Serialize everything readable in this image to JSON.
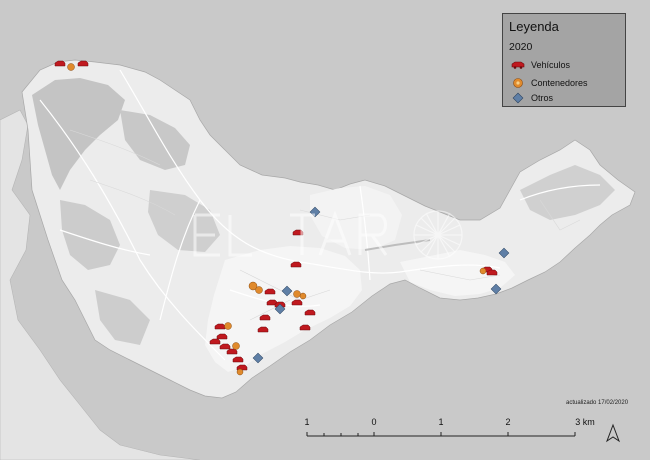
{
  "legend": {
    "title": "Leyenda",
    "year": "2020",
    "items": [
      {
        "label": "Vehículos",
        "symbol": "car-icon",
        "color": "#c0191f"
      },
      {
        "label": "Contenedores",
        "symbol": "container-icon",
        "color": "#e08a2c"
      },
      {
        "label": "Otros",
        "symbol": "diamond-icon",
        "color": "#5f7fa6"
      }
    ]
  },
  "updated_text": "actualizado 17/02/2020",
  "scalebar": {
    "labels": [
      {
        "text": "1",
        "value": -1
      },
      {
        "text": "0",
        "value": 0
      },
      {
        "text": "1",
        "value": 1
      },
      {
        "text": "2",
        "value": 2
      },
      {
        "text": "3 km",
        "value": 3
      }
    ]
  },
  "colors": {
    "sea": "#c9c9c9",
    "land": "#ececec",
    "urban": "#f7f7f7",
    "green": "#c6c6c6",
    "legend_bg": "#a4a4a4"
  }
}
